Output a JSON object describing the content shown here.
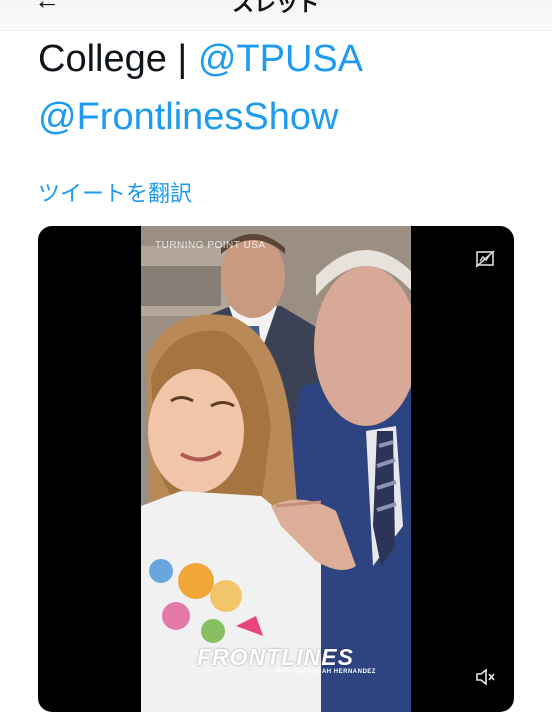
{
  "header": {
    "title": "スレッド",
    "back_icon": "arrow-left-icon"
  },
  "tweet": {
    "text_prefix": "College | ",
    "mention_1": "@TPUSA",
    "mention_2": "@FrontlinesShow",
    "translate_label": "ツイートを翻訳"
  },
  "media": {
    "watermark_text": "TURNING POINT USA",
    "overlay_logo": "FRONTLINES",
    "overlay_sub": "WITH SAVANNAH HERNANDEZ",
    "hide_icon": "sensitive-hide-icon",
    "mute_icon": "speaker-muted-icon"
  },
  "colors": {
    "link": "#1d9bf0",
    "text": "#0f1419",
    "media_bg": "#000000"
  }
}
